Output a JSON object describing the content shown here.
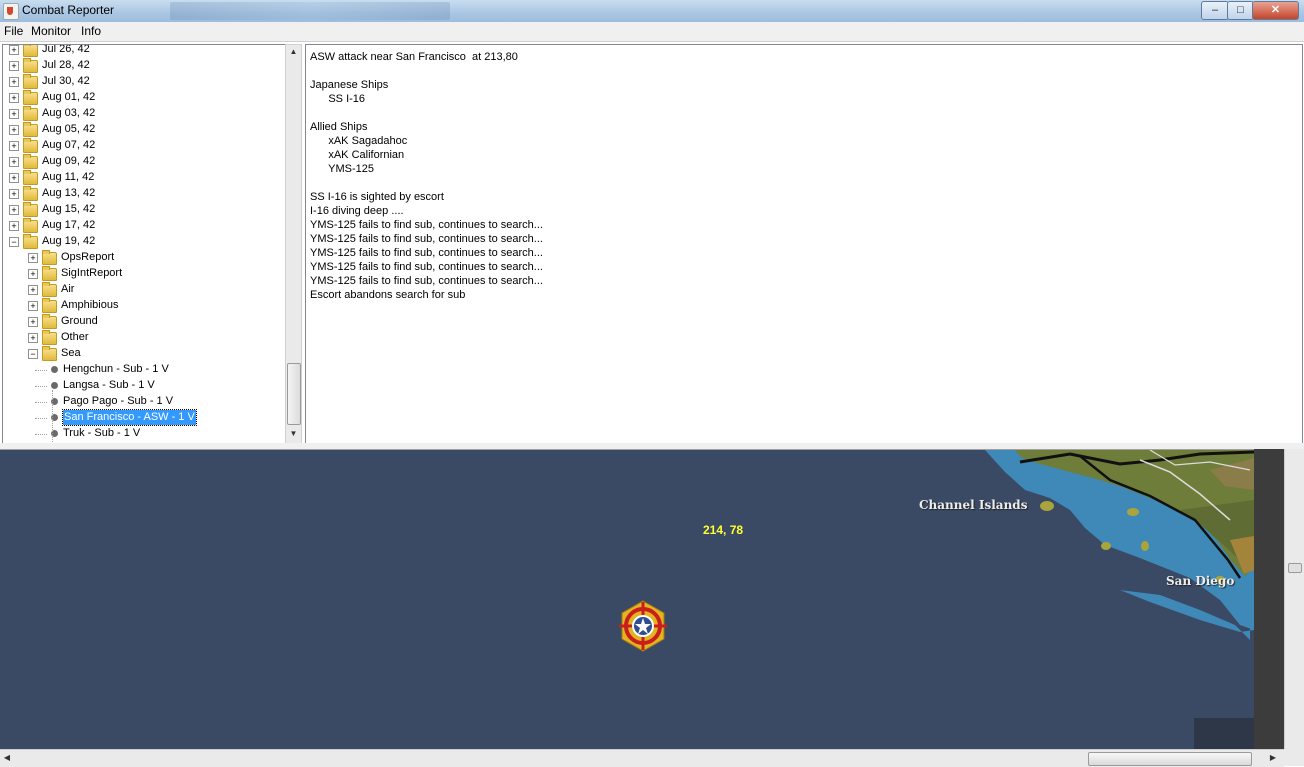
{
  "window": {
    "title": "Combat Reporter",
    "controls": {
      "minimize": "–",
      "maximize": "□",
      "close": "✕"
    }
  },
  "menu": [
    "File",
    "Monitor",
    "Info"
  ],
  "tree": {
    "dates": [
      "Jul 26, 42",
      "Jul 28, 42",
      "Jul 30, 42",
      "Aug 01, 42",
      "Aug 03, 42",
      "Aug 05, 42",
      "Aug 07, 42",
      "Aug 09, 42",
      "Aug 11, 42",
      "Aug 13, 42",
      "Aug 15, 42",
      "Aug 17, 42",
      "Aug 19, 42"
    ],
    "expanded_date": "Aug 19, 42",
    "categories": [
      "OpsReport",
      "SigIntReport",
      "Air",
      "Amphibious",
      "Ground",
      "Other",
      "Sea"
    ],
    "expanded_category": "Sea",
    "sea_items": [
      "Hengchun  - Sub - 1 V",
      "Langsa  - Sub - 1 V",
      "Pago Pago  - Sub - 1 V",
      "San Francisco  - ASW - 1 V",
      "Truk  - Sub - 1 V"
    ],
    "selected_item": "San Francisco  - ASW - 1 V"
  },
  "report": {
    "lines": [
      "ASW attack near San Francisco  at 213,80",
      "",
      "Japanese Ships",
      "      SS I-16",
      "",
      "Allied Ships",
      "      xAK Sagadahoc",
      "      xAK Californian",
      "      YMS-125",
      "",
      "SS I-16 is sighted by escort",
      "I-16 diving deep ....",
      "YMS-125 fails to find sub, continues to search...",
      "YMS-125 fails to find sub, continues to search...",
      "YMS-125 fails to find sub, continues to search...",
      "YMS-125 fails to find sub, continues to search...",
      "YMS-125 fails to find sub, continues to search...",
      "Escort abandons search for sub"
    ]
  },
  "map": {
    "coordinate_label": "214, 78",
    "places": [
      "Channel Islands",
      "San Diego"
    ],
    "marker_icon": "combat-target-star-icon",
    "colors": {
      "ocean": "#3a4a65",
      "shallow": "#3f89b8",
      "land": "#6f7d3a",
      "marker_red": "#c81e1e",
      "marker_gold": "#e3b320"
    }
  }
}
